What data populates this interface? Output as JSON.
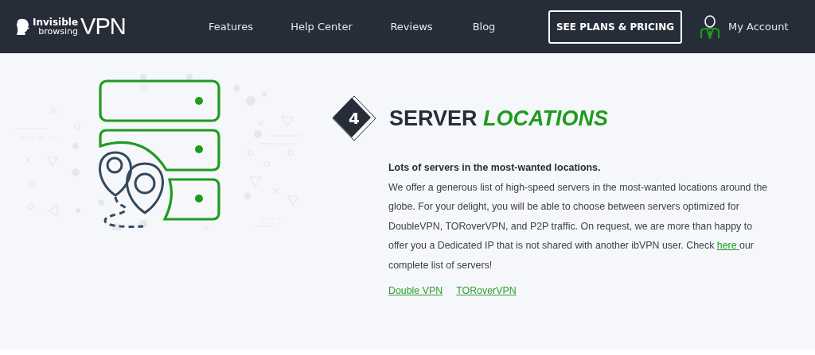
{
  "header": {
    "logo": {
      "top": "Invisible",
      "bottom": "browsing",
      "big": "VPN"
    },
    "nav": [
      {
        "label": "Features"
      },
      {
        "label": "Help Center"
      },
      {
        "label": "Reviews"
      },
      {
        "label": "Blog"
      }
    ],
    "cta": "SEE PLANS & PRICING",
    "account": "My Account"
  },
  "section": {
    "number": "4",
    "title": "SERVER",
    "title_accent": "LOCATIONS",
    "lead": "Lots of servers in the most-wanted locations.",
    "body_before": "We offer a generous list of high-speed servers in the most-wanted locations around the globe. For your delight, you will be able to choose between servers optimized for DoubleVPN, TORoverVPN, and P2P traffic. On request, we are more than happy to offer you a Dedicated IP that is not shared with another ibVPN user. Check ",
    "link": "here ",
    "body_after": "our complete list of servers!",
    "links": [
      {
        "label": "Double VPN"
      },
      {
        "label": "TORoverVPN"
      }
    ]
  }
}
